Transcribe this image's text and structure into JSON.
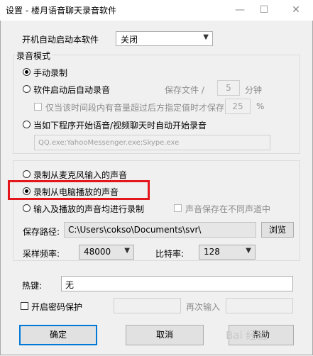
{
  "window": {
    "title": "设置 - 楼月语音聊天录音软件",
    "minimize_glyph": "—",
    "maximize_glyph": "☐",
    "close_glyph": "✕"
  },
  "autostart": {
    "label": "开机自动启动本软件",
    "value": "关闭"
  },
  "record_mode": {
    "group_title": "录音模式",
    "manual": "手动录制",
    "auto_after_start": "软件启动后自动录音",
    "save_file_label": "保存文件 /",
    "save_file_value": "5",
    "minutes_unit": "分钟",
    "only_save_label": "仅当该时间段内有音量超过后方指定值时才保存",
    "threshold_value": "25",
    "percent_unit": "%",
    "auto_on_programs": "当如下程序开始语音/视频聊天时自动开始录音",
    "programs_value": "QQ.exe;YahooMessenger.exe;Skype.exe"
  },
  "source": {
    "mic": "录制从麦克风输入的声音",
    "pc": "录制从电脑播放的声音",
    "both": "输入及播放的声音均进行录制",
    "separate_channels": "声音保存在不同声道中",
    "save_path_label": "保存路径:",
    "save_path_value": "C:\\Users\\cokso\\Documents\\svr\\",
    "browse": "浏览",
    "sample_rate_label": "采样频率:",
    "sample_rate_value": "48000",
    "bitrate_label": "比特率:",
    "bitrate_value": "128"
  },
  "hotkey": {
    "label": "热键:",
    "value": "无"
  },
  "password": {
    "enable_label": "开启密码保护",
    "reenter_label": "再次输入"
  },
  "buttons": {
    "ok": "确定",
    "cancel": "取消",
    "help": "帮助"
  },
  "watermark": "Bai 经验",
  "colors": {
    "highlight": "#e3161c",
    "default_button_border": "#0078d7"
  }
}
